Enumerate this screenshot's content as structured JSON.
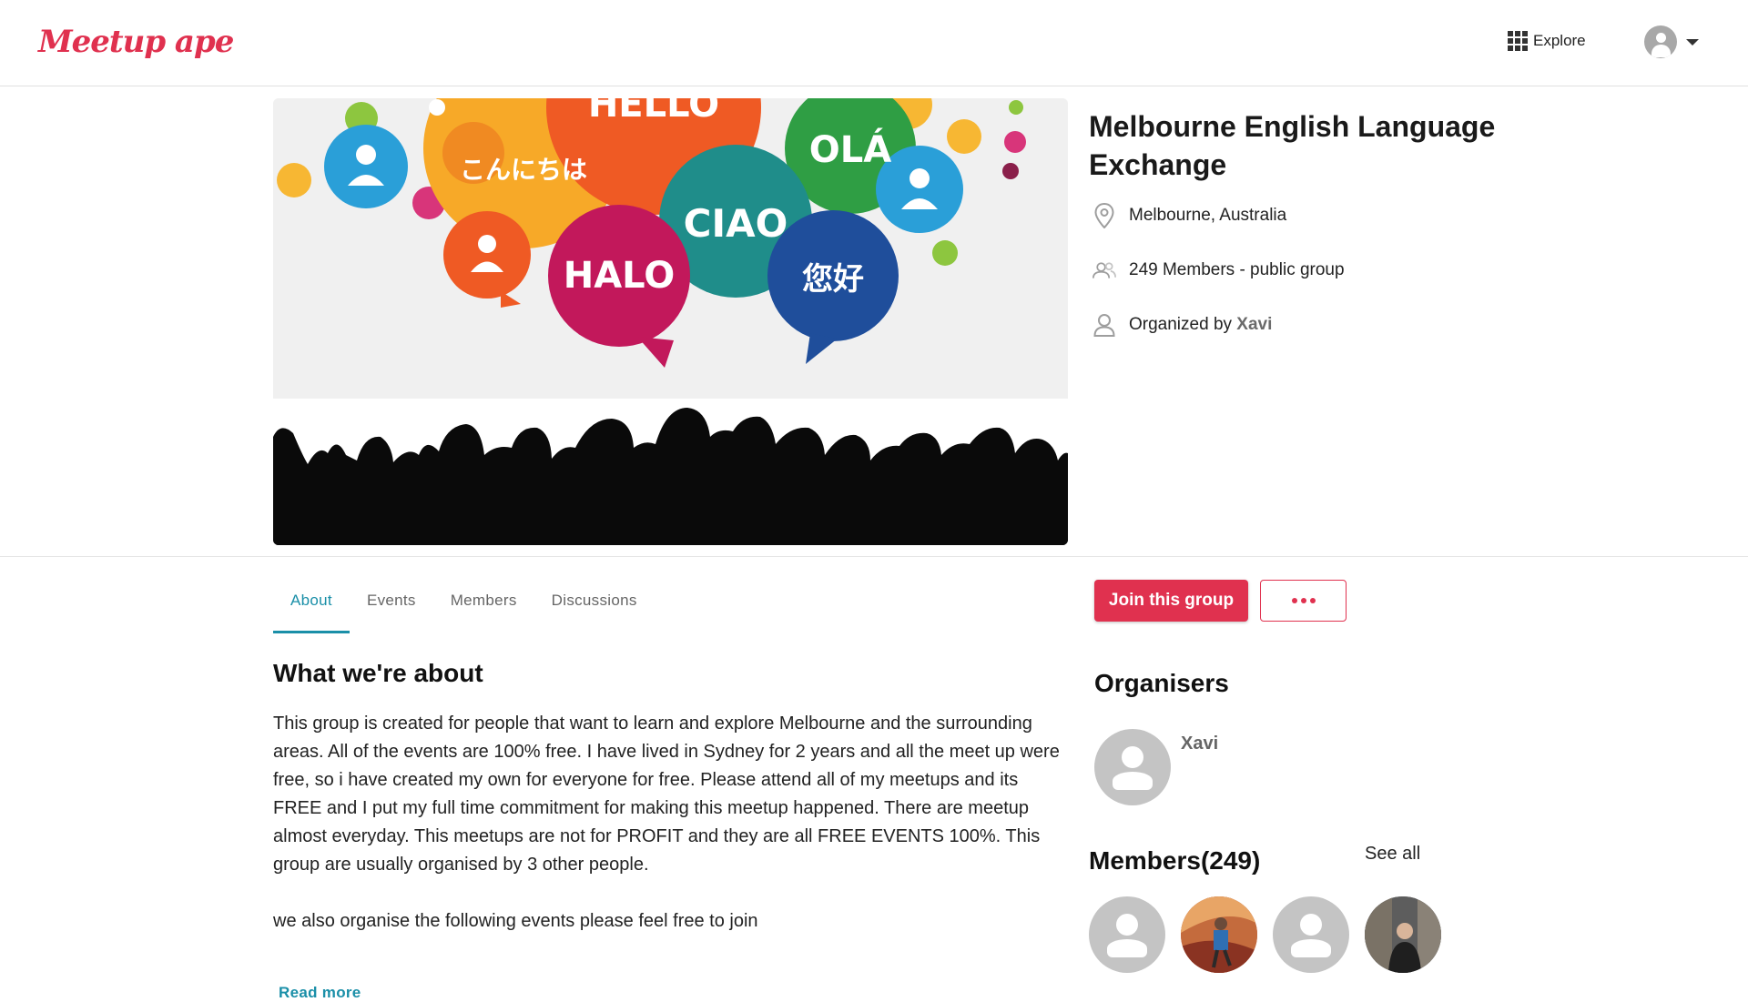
{
  "header": {
    "logo_text": "Meetup ape",
    "explore_label": "Explore",
    "icons": {
      "explore": "grid-icon",
      "profile": "user-avatar-icon",
      "menu": "caret-down-icon"
    }
  },
  "hero": {
    "image_alt": "Language exchange banner",
    "bubble_words": [
      "HELLO",
      "こんにちは",
      "OLÁ",
      "CIAO",
      "HALO",
      "您好"
    ]
  },
  "group": {
    "title": "Melbourne English Language Exchange",
    "location": "Melbourne, Australia",
    "members_text": "249 Members - public group",
    "organized_by_prefix": "Organized by",
    "organizer": "Xavi",
    "icons": {
      "location": "location-pin-icon",
      "members": "people-icon",
      "organizer": "person-icon"
    }
  },
  "tabs": [
    {
      "label": "About",
      "active": true
    },
    {
      "label": "Events",
      "active": false
    },
    {
      "label": "Members",
      "active": false
    },
    {
      "label": "Discussions",
      "active": false
    }
  ],
  "actions": {
    "join_label": "Join this group",
    "more_icon": "more-dots-icon"
  },
  "about": {
    "heading": "What we're about",
    "paragraph1": "This group is created for people that want to learn and explore Melbourne and the surrounding areas. All of the events are 100% free. I have lived in Sydney for 2 years and all the meet up were free, so i have created my own for everyone for free. Please attend all of my meetups and its FREE and I put my full time commitment for making this meetup happened. There are meetup almost everyday. This meetups are not for PROFIT and they are all FREE EVENTS 100%.  This group are usually organised by 3 other people.",
    "paragraph2": "we also organise the following events please feel free to join",
    "read_more": "Read more"
  },
  "organisers": {
    "heading": "Organisers",
    "items": [
      {
        "name": "Xavi"
      }
    ]
  },
  "members": {
    "heading": "Members(249)",
    "see_all": "See all",
    "avatars": [
      "default",
      "photo",
      "default",
      "photo"
    ]
  },
  "colors": {
    "brand": "#e0314f",
    "accent": "#1a8fa8",
    "text": "#212121",
    "muted": "#666666"
  }
}
